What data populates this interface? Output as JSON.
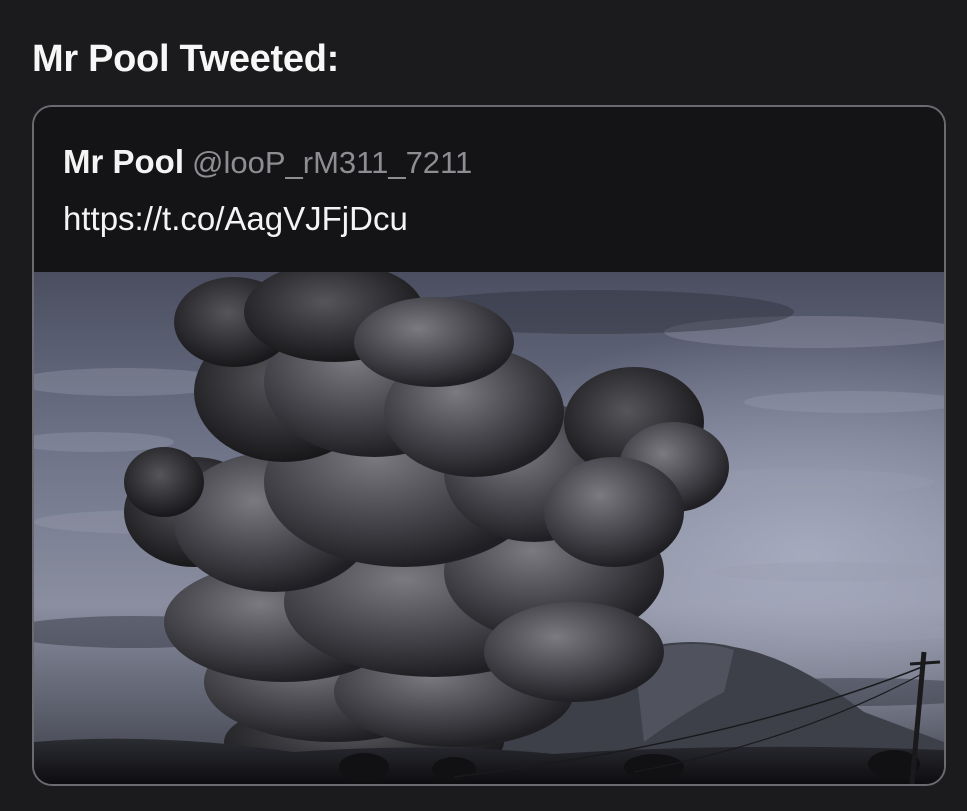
{
  "header": {
    "title": "Mr Pool Tweeted:"
  },
  "tweet": {
    "author_name": "Mr Pool",
    "author_handle": "@looP_rM311_7211",
    "text": "https://t.co/AagVJFjDcu",
    "media": {
      "kind": "photo",
      "subject": "volcanic-eruption-ash-cloud"
    }
  },
  "colors": {
    "background": "#1b1b1d",
    "card_background": "#141416",
    "card_border": "#6a6a70",
    "primary_text": "#f4f4f4",
    "secondary_text": "#8d8d92"
  }
}
